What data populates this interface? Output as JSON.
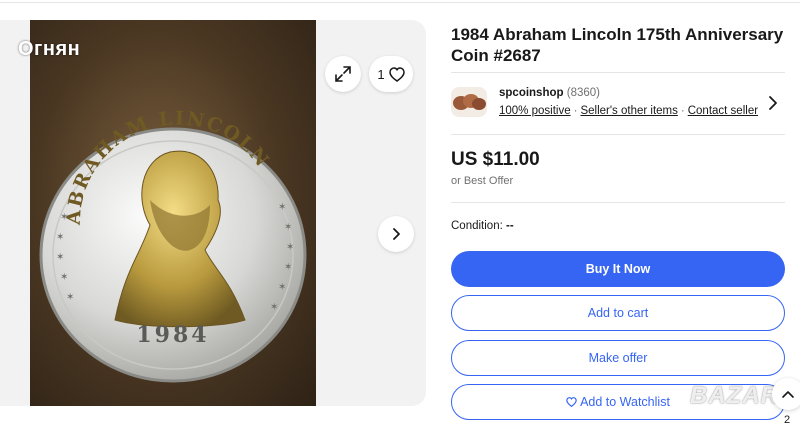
{
  "watermark_top": "Огнян",
  "watermark_bottom": "BAZAR",
  "gallery": {
    "coin_top_text": "ABRAHAM LINCOLN",
    "coin_year": "1984",
    "watch_count": "1"
  },
  "listing": {
    "title": "1984 Abraham Lincoln 175th Anniversary Coin #2687",
    "seller": {
      "name": "spcoinshop",
      "score": "(8360)",
      "positive": "100% positive",
      "other_items": "Seller's other items",
      "contact": "Contact seller",
      "separator": "·"
    },
    "price": "US $11.00",
    "best_offer": "or Best Offer",
    "condition_label": "Condition:",
    "condition_value": "--"
  },
  "buttons": {
    "buy_now": "Buy It Now",
    "add_to_cart": "Add to cart",
    "make_offer": "Make offer",
    "add_to_watchlist": "Add to Watchlist"
  },
  "help_digit": "2",
  "colors": {
    "accent": "#3665f3",
    "text": "#191919",
    "muted": "#707070",
    "gallery_bg": "#f2f2f2"
  },
  "icons": [
    "expand-icon",
    "heart-icon",
    "chevron-right-icon",
    "heart-outline-icon"
  ]
}
